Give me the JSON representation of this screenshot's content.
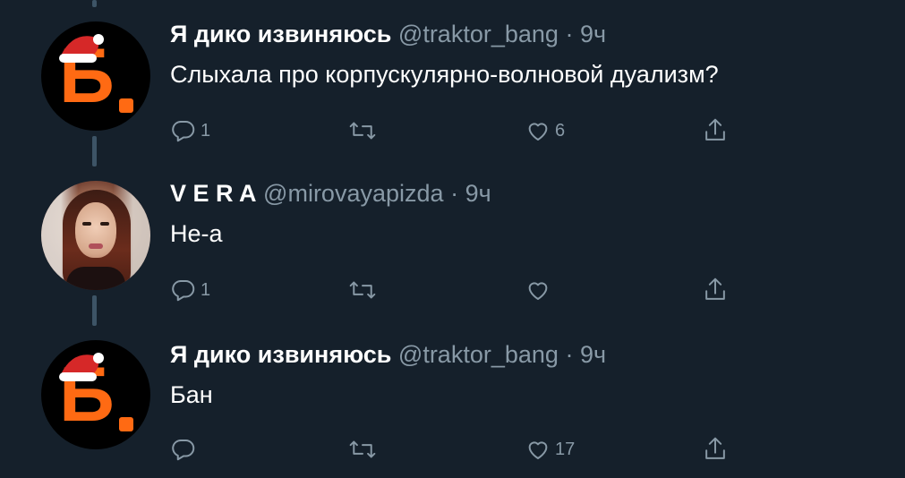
{
  "tweets": [
    {
      "author": "Я дико извиняюсь",
      "handle": "@traktor_bang",
      "separator": "·",
      "time": "9ч",
      "text": "Слыхала про корпускулярно-волновой дуализм?",
      "avatar": "brand-logo-b",
      "reply_count": "1",
      "retweet_count": "",
      "like_count": "6"
    },
    {
      "author": "V E R A",
      "handle": "@mirovayapizda",
      "separator": "·",
      "time": "9ч",
      "text": "Не-а",
      "avatar": "photo",
      "reply_count": "1",
      "retweet_count": "",
      "like_count": ""
    },
    {
      "author": "Я дико извиняюсь",
      "handle": "@traktor_bang",
      "separator": "·",
      "time": "9ч",
      "text": "Бан",
      "avatar": "brand-logo-b",
      "reply_count": "",
      "retweet_count": "",
      "like_count": "17"
    }
  ],
  "brand_logo": {
    "letter": "Б",
    "accent_color": "#ff6a13"
  },
  "colors": {
    "background": "#15202b",
    "secondary_text": "#8899a6",
    "thread_line": "#3d5466"
  },
  "icons": [
    "reply-icon",
    "retweet-icon",
    "like-icon",
    "share-icon",
    "santa-hat-icon"
  ]
}
